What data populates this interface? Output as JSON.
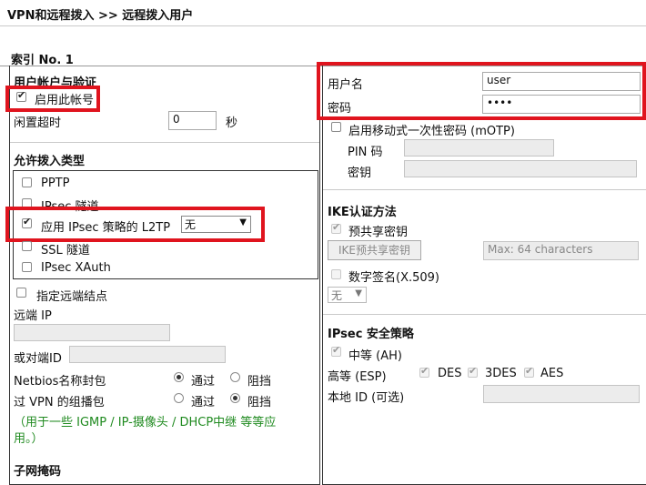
{
  "breadcrumb": "VPN和远程拨入 >> 远程拨入用户",
  "index_title": "索引 No. 1",
  "account": {
    "section_title": "用户帐户与验证",
    "enable_label": "启用此帐号",
    "enable_checked": true,
    "idle_label": "闲置超时",
    "idle_value": "0",
    "idle_unit": "秒"
  },
  "dialin": {
    "section_title": "允许拨入类型",
    "pptp_label": "PPTP",
    "ipsec_tunnel_label": "IPsec 隧道",
    "l2tp_label": "应用 IPsec 策略的 L2TP",
    "l2tp_policy": "无",
    "ssl_label": "SSL 隧道",
    "xauth_label": "IPsec XAuth"
  },
  "remote": {
    "specify_label": "指定远端结点",
    "remote_ip_label": "远端 IP",
    "peer_id_label": "或对端ID",
    "netbios_label": "Netbios名称封包",
    "multicast_label": "过 VPN 的组播包",
    "pass_label": "通过",
    "block_label": "阻挡",
    "note_line1": "（用于一些 IGMP / IP-摄像头 / DHCP中继 等等应",
    "note_line2": "用。）",
    "subnet_label": "子网掩码"
  },
  "credentials": {
    "username_label": "用户名",
    "username_value": "user",
    "password_label": "密码",
    "password_value": "••••",
    "motp_label": "启用移动式一次性密码 (mOTP)",
    "pin_label": "PIN 码",
    "key_label": "密钥"
  },
  "ike": {
    "section_title": "IKE认证方法",
    "psk_label": "预共享密钥",
    "psk_button": "IKE预共享密钥",
    "psk_placeholder": "Max: 64 characters",
    "cert_label": "数字签名(X.509)",
    "cert_value": "无"
  },
  "ipsec": {
    "section_title": "IPsec 安全策略",
    "medium_label": "中等 (AH)",
    "high_label": "高等 (ESP)",
    "des_label": "DES",
    "3des_label": "3DES",
    "aes_label": "AES",
    "local_id_label": "本地 ID (可选)"
  },
  "colors": {
    "highlight": "#e0141e",
    "note": "#1f8a1f"
  }
}
